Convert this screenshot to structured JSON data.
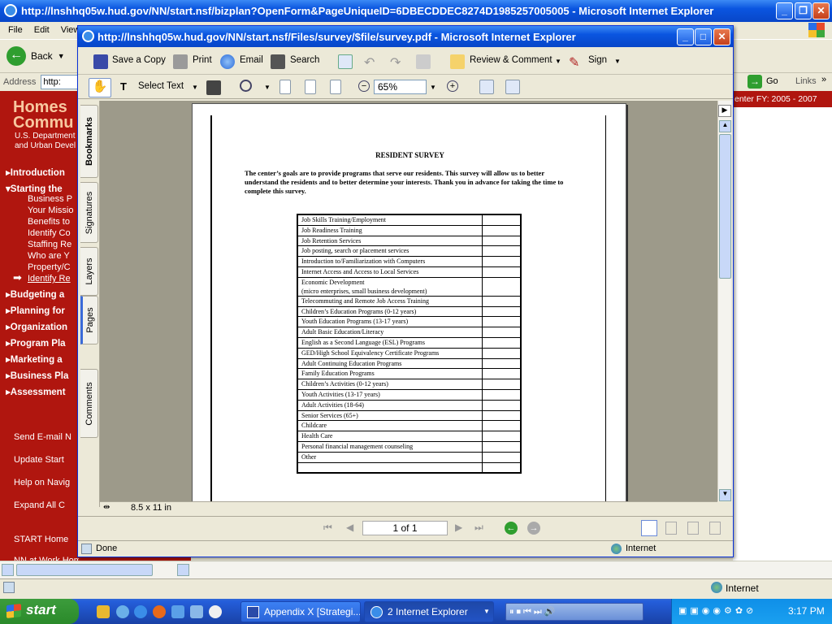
{
  "outer_window": {
    "title": "http://lnshhq05w.hud.gov/NN/start.nsf/bizplan?OpenForm&PageUniqueID=6DBECDDEC8274D1985257005005 - Microsoft Internet Explorer",
    "menu": [
      "File",
      "Edit",
      "View"
    ],
    "back_label": "Back",
    "address_label": "Address",
    "address_value": "http:",
    "go_label": "Go",
    "links_label": "Links",
    "status_text": "",
    "zone_text": "Internet"
  },
  "site_sidebar": {
    "brand_line1": "Homes",
    "brand_line2": "Commu",
    "dept_line1": "U.S. Department",
    "dept_line2": "and Urban Devel",
    "sections": [
      "Introduction",
      "Starting the",
      "Budgeting a",
      "Planning for",
      "Organization",
      "Program Pla",
      "Marketing a",
      "Business Pla",
      "Assessment"
    ],
    "subitems": [
      "Business P",
      "Your Missio",
      "Benefits to",
      "Identify Co",
      "Staffing Re",
      "Who are Y",
      "Property/C",
      "Identify Re"
    ],
    "links": [
      "Send E-mail N",
      "Update Start",
      "Help on Navig",
      "Expand All  C",
      "START Home",
      "NN at Work Home"
    ],
    "right_header": "enter   FY: 2005 - 2007"
  },
  "pdf_window": {
    "title": "http://lnshhq05w.hud.gov/NN/start.nsf/Files/survey/$file/survey.pdf - Microsoft Internet Explorer",
    "toolbar1": {
      "save": "Save a Copy",
      "print": "Print",
      "email": "Email",
      "search": "Search",
      "review": "Review & Comment",
      "sign": "Sign"
    },
    "toolbar2": {
      "select_text": "Select Text",
      "zoom": "65%"
    },
    "nav_tabs": [
      "Bookmarks",
      "Signatures",
      "Layers",
      "Pages",
      "Comments"
    ],
    "page_size": "8.5 x 11 in",
    "page_indicator": "1 of 1",
    "status_text": "Done",
    "zone_text": "Internet"
  },
  "document": {
    "title": "RESIDENT SURVEY",
    "intro": "The center’s goals are to provide programs that serve our residents.  This survey will allow us to better understand the residents and to better determine your interests.  Thank you in advance for taking the time to complete this survey.",
    "rows": [
      "Job Skills Training/Employment",
      "Job Readiness Training",
      "Job Retention Services",
      "Job posting, search or placement services",
      "Introduction to/Familiarization with Computers",
      "Internet Access and Access to Local Services",
      "Economic Development\n(micro enterprises, small business development)",
      "Telecommuting and Remote Job Access Training",
      "Children’s Education Programs (0-12 years)",
      "Youth Education Programs (13-17 years)",
      "Adult Basic Education/Literacy",
      "English as a Second Language (ESL) Programs",
      "GED/High School Equivalency Certificate Programs",
      "Adult Continuing Education Programs",
      "Family Education Programs",
      "Children’s Activities (0-12 years)",
      "Youth Activities (13-17 years)",
      "Adult Activities (18-64)",
      "Senior Services (65+)",
      "Childcare",
      "Health Care",
      "Personal financial management counseling",
      "Other",
      ""
    ]
  },
  "taskbar": {
    "start": "start",
    "tasks": [
      "Appendix X [Strategi...",
      "2 Internet Explorer"
    ],
    "clock": "3:17 PM"
  }
}
